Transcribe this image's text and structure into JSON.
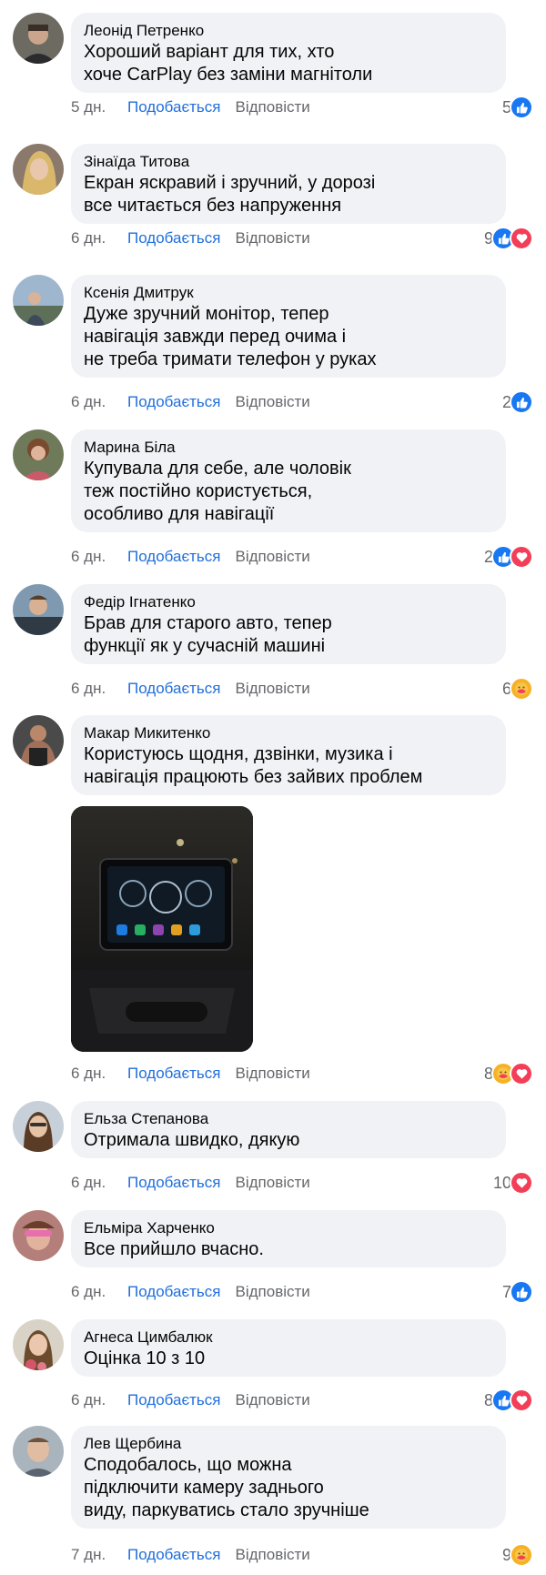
{
  "labels": {
    "like": "Подобається",
    "reply": "Відповісти"
  },
  "comments": [
    {
      "author": "Леонід Петренко",
      "lines": [
        "Хороший варіант для тих, хто",
        "хоче CarPlay без заміни магнітоли"
      ],
      "time": "5 дн.",
      "count": "5",
      "reactions": [
        "like"
      ]
    },
    {
      "author": "Зінаїда Титова",
      "lines": [
        "Екран яскравий і зручний, у дорозі",
        "все читається без напруження"
      ],
      "time": "6 дн.",
      "count": "9",
      "reactions": [
        "like",
        "love"
      ]
    },
    {
      "author": "Ксенія Дмитрук",
      "lines": [
        "Дуже зручний монітор, тепер",
        "навігація завжди перед очима і",
        "не треба тримати телефон у руках"
      ],
      "time": "6 дн.",
      "count": "2",
      "reactions": [
        "like"
      ]
    },
    {
      "author": "Марина Біла",
      "lines": [
        "Купувала для себе, але чоловік",
        "теж постійно користується,",
        "особливо для навігації"
      ],
      "time": "6 дн.",
      "count": "2",
      "reactions": [
        "like",
        "love"
      ]
    },
    {
      "author": "Федір Ігнатенко",
      "lines": [
        "Брав для старого авто, тепер",
        "функції як у сучасній машині"
      ],
      "time": "6 дн.",
      "count": "6",
      "reactions": [
        "care"
      ]
    },
    {
      "author": "Макар Микитенко",
      "lines": [
        "Користуюсь щодня, дзвінки, музика і",
        "навігація працюють без зайвих проблем"
      ],
      "time": "6 дн.",
      "count": "8",
      "reactions": [
        "care",
        "love"
      ],
      "has_photo": true
    },
    {
      "author": "Ельза Степанова",
      "lines": [
        "Отримала швидко, дякую"
      ],
      "time": "6 дн.",
      "count": "10",
      "reactions": [
        "love"
      ]
    },
    {
      "author": "Ельміра Харченко",
      "lines": [
        "Все прийшло вчасно."
      ],
      "time": "6 дн.",
      "count": "7",
      "reactions": [
        "like"
      ]
    },
    {
      "author": "Агнеса Цимбалюк",
      "lines": [
        "Оцінка 10 з 10"
      ],
      "time": "6 дн.",
      "count": "8",
      "reactions": [
        "like",
        "love"
      ]
    },
    {
      "author": "Лев Щербина",
      "lines": [
        "Сподобалось, що можна",
        "підключити камеру заднього",
        "виду, паркуватись стало зручніше"
      ],
      "time": "7 дн.",
      "count": "9",
      "reactions": [
        "care"
      ]
    }
  ]
}
